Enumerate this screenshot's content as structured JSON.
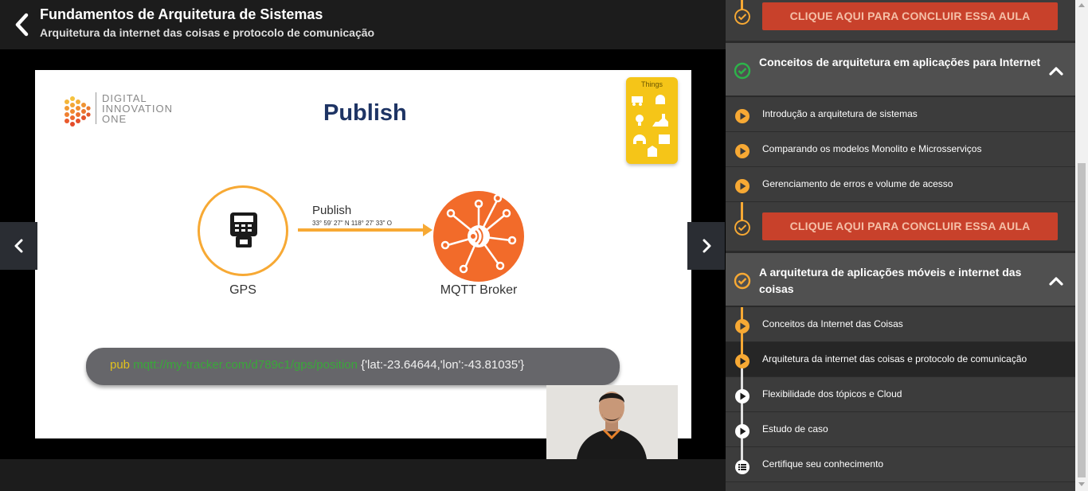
{
  "header": {
    "course_title": "Fundamentos de Arquitetura de Sistemas",
    "lesson_title": "Arquitetura da internet das coisas e protocolo de comunicação"
  },
  "slide": {
    "logo_lines": [
      "DIGITAL",
      "INNOVATION",
      "ONE"
    ],
    "title": "Publish",
    "things_label": "Things",
    "gps_label": "GPS",
    "arrow_label": "Publish",
    "arrow_coords": "33° 59' 27\" N 118° 27' 33\" O",
    "broker_label": "MQTT Broker",
    "command": {
      "pub": "pub",
      "topic": " mqtt://my-tracker.com/d789c1/gps/position ",
      "payload": "{'lat:-23.64644,'lon':-43.81035'}"
    }
  },
  "sidebar": {
    "items": [
      {
        "type": "conclude",
        "label": "CLIQUE AQUI PARA CONCLUIR ESSA AULA",
        "status": "done"
      },
      {
        "type": "section",
        "label": "Conceitos de arquitetura em aplicações para Internet",
        "status": "complete"
      },
      {
        "type": "lesson",
        "label": "Introdução a arquitetura de sistemas",
        "status": "in-progress"
      },
      {
        "type": "lesson",
        "label": "Comparando os modelos Monolito e Microsserviços",
        "status": "in-progress"
      },
      {
        "type": "lesson",
        "label": "Gerenciamento de erros e volume de acesso",
        "status": "in-progress"
      },
      {
        "type": "conclude",
        "label": "CLIQUE AQUI PARA CONCLUIR ESSA AULA",
        "status": "done"
      },
      {
        "type": "section",
        "label": "A arquitetura de aplicações móveis e internet das coisas",
        "status": "partial"
      },
      {
        "type": "lesson",
        "label": "Conceitos da Internet das Coisas",
        "status": "in-progress"
      },
      {
        "type": "lesson",
        "label": "Arquitetura da internet das coisas e protocolo de comunicação",
        "status": "in-progress",
        "active": true
      },
      {
        "type": "lesson",
        "label": "Flexibilidade dos tópicos e Cloud",
        "status": "not-started"
      },
      {
        "type": "lesson",
        "label": "Estudo de caso",
        "status": "not-started"
      },
      {
        "type": "quiz",
        "label": "Certifique seu conhecimento",
        "status": "not-started"
      }
    ]
  },
  "colors": {
    "accent": "#f7a934",
    "conclude_button": "#c8412b",
    "broker": "#f26b2a",
    "check_green": "#2db34a",
    "title_navy": "#1e3464"
  }
}
